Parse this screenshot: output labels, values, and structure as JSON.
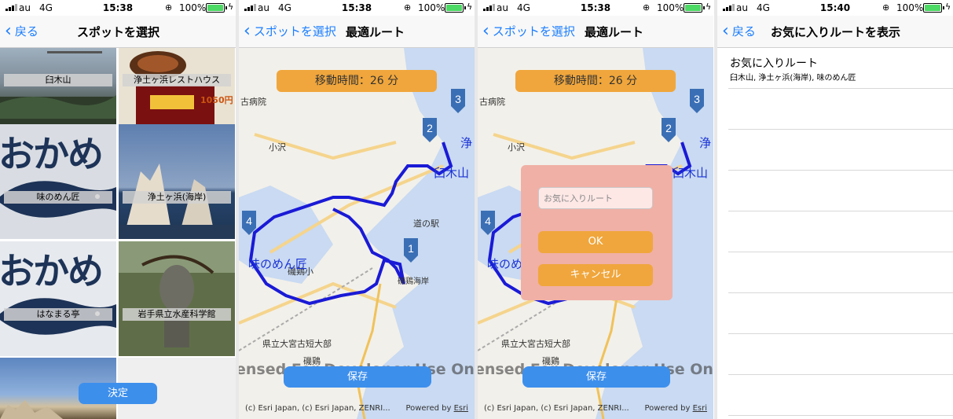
{
  "statusbar": {
    "carrier": "au",
    "network": "4G",
    "battery": "100%",
    "times": [
      "15:38",
      "15:38",
      "15:38",
      "15:40"
    ]
  },
  "screen1": {
    "back_label": "戻る",
    "title": "スポットを選択",
    "spots": [
      "臼木山",
      "浄土ヶ浜レストハウス",
      "味のめん匠",
      "浄土ヶ浜(海岸)",
      "はなまる亭",
      "岩手県立水産科学館"
    ],
    "image_text": {
      "okame": "おかめ",
      "price": "1050円"
    },
    "decide_label": "決定"
  },
  "screen2": {
    "back_label": "スポットを選択",
    "title": "最適ルート",
    "travel_time": "移動時間：26 分",
    "save_label": "保存",
    "attribution": "(c) Esri Japan, (c) Esri Japan, ZENRI...",
    "powered_prefix": "Powered by ",
    "powered_link": "Esri",
    "watermark": "ensed For Developer Use Only",
    "map_labels": {
      "hospital": "古病院",
      "ozawa": "小沢",
      "michinoeki": "道の駅",
      "isokei_elem": "磯鶏小",
      "isokei_coast": "磯鶏海岸",
      "college": "県立大宮古短大部",
      "isokei": "磯鶏",
      "usukiyama": "臼木山",
      "jodo": "浄",
      "menshou": "味のめん匠"
    },
    "pins": [
      "1",
      "2",
      "3",
      "4"
    ]
  },
  "screen3": {
    "back_label": "スポットを選択",
    "title": "最適ルート",
    "travel_time": "移動時間：26 分",
    "dialog": {
      "placeholder": "お気に入りルート",
      "ok_label": "OK",
      "cancel_label": "キャンセル"
    },
    "save_label": "保存",
    "attribution": "(c) Esri Japan, (c) Esri Japan, ZENRI...",
    "powered_prefix": "Powered by ",
    "powered_link": "Esri",
    "watermark": "ensed For Developer Use Only"
  },
  "screen4": {
    "back_label": "戻る",
    "title": "お気に入りルートを表示",
    "favorites": [
      {
        "title": "お気に入りルート",
        "subtitle": "臼木山, 浄土ヶ浜(海岸), 味のめん匠"
      }
    ]
  },
  "colors": {
    "ios_blue": "#1a7dff",
    "button_blue": "#3d8fec",
    "orange": "#f0a63c",
    "route": "#1a1ad6",
    "pin": "#3b6fb5",
    "dialog_bg": "#f0b0a6"
  }
}
